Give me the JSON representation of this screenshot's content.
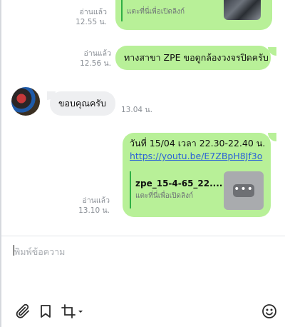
{
  "messages": [
    {
      "read_label": "อ่านแล้ว",
      "time": "12.55 น.",
      "preview_subtitle": "แตะที่นี่เพื่อเปิดลิงก์"
    },
    {
      "read_label": "อ่านแล้ว",
      "time": "12.56 น.",
      "text": "ทางสาขา ZPE ขอดูกล้องวงจรปิดครับ"
    },
    {
      "time": "13.04 น.",
      "text": "ขอบคุณครับ"
    },
    {
      "read_label": "อ่านแล้ว",
      "time": "13.10 น.",
      "text": "วันที่ 15/04 เวลา 22.30-22.40 น.",
      "link": "https://youtu.be/E7ZBpH8Jf3o",
      "preview_title": "zpe_15-4-65_22....",
      "preview_subtitle": "แตะที่นี่เพื่อเปิดลิงก์"
    }
  ],
  "composer": {
    "placeholder": "พิมพ์ข้อความ"
  },
  "toolbar": {
    "icons": [
      "paperclip-icon",
      "bookmark-icon",
      "crop-icon",
      "emoji-icon"
    ]
  },
  "colors": {
    "outgoing_bubble": "#b8f098",
    "incoming_bubble": "#eeeff1",
    "link": "#2a62d6",
    "preview_bar": "#2fb044"
  }
}
